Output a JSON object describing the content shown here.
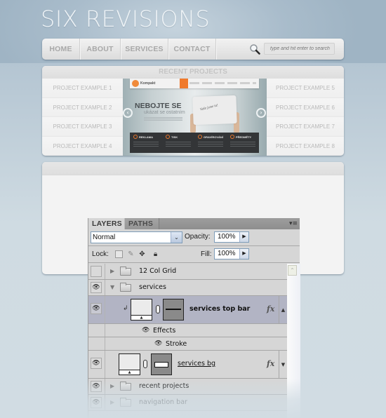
{
  "site": {
    "title": "SIX REVISIONS",
    "nav": [
      "HOME",
      "ABOUT",
      "SERVICES",
      "CONTACT"
    ],
    "search_placeholder": "type and hit enter to search"
  },
  "recent_projects": {
    "title": "RECENT PROJECTS",
    "left": [
      "PROJECT EXAMPLE 1",
      "PROJECT EXAMPLE 2",
      "PROJECT EXAMPLE 3",
      "PROJECT EXAMPLE 4"
    ],
    "right": [
      "PROJECT EXAMPLE 5",
      "PROJECT EXAMPLE 6",
      "PROJECT EXAMPLE 7",
      "PROJECT EXAMPLE 8"
    ],
    "carousel": {
      "brand": "Kompakt",
      "heading": "NEBOJTE SE",
      "subheading": "ukázat se ostatním",
      "paper_text": "Vaše jsme tu!",
      "features": [
        "REKLAMA",
        "TISK",
        "GRAVÍROVÁNÍ",
        "PŘEDMĚTY"
      ],
      "prev_icon": "‹",
      "next_icon": "›"
    }
  },
  "layers_panel": {
    "tabs": [
      "LAYERS",
      "PATHS"
    ],
    "menu_icon": "▾≡",
    "blend_mode": "Normal",
    "opacity_label": "Opacity:",
    "opacity_value": "100%",
    "lock_label": "Lock:",
    "fill_label": "Fill:",
    "fill_value": "100%",
    "layers": [
      {
        "name": "12 Col Grid",
        "type": "group",
        "visible": false,
        "expanded": false
      },
      {
        "name": "services",
        "type": "group",
        "visible": true,
        "expanded": true
      },
      {
        "name": "services top bar",
        "type": "layer",
        "visible": true,
        "selected": true,
        "clipped": true,
        "fx": "fx"
      },
      {
        "name": "Effects",
        "type": "effects"
      },
      {
        "name": "Stroke",
        "type": "effect"
      },
      {
        "name": "services bg",
        "type": "layer",
        "visible": true,
        "fx": "fx"
      },
      {
        "name": "recent projects",
        "type": "group",
        "visible": true,
        "expanded": false
      },
      {
        "name": "navigation bar",
        "type": "group",
        "visible": true,
        "expanded": false
      }
    ]
  },
  "colors": {
    "accent_orange": "#f07a2c",
    "selected_layer": "#b2b4c4",
    "panel_bg": "#d6d6d6"
  }
}
